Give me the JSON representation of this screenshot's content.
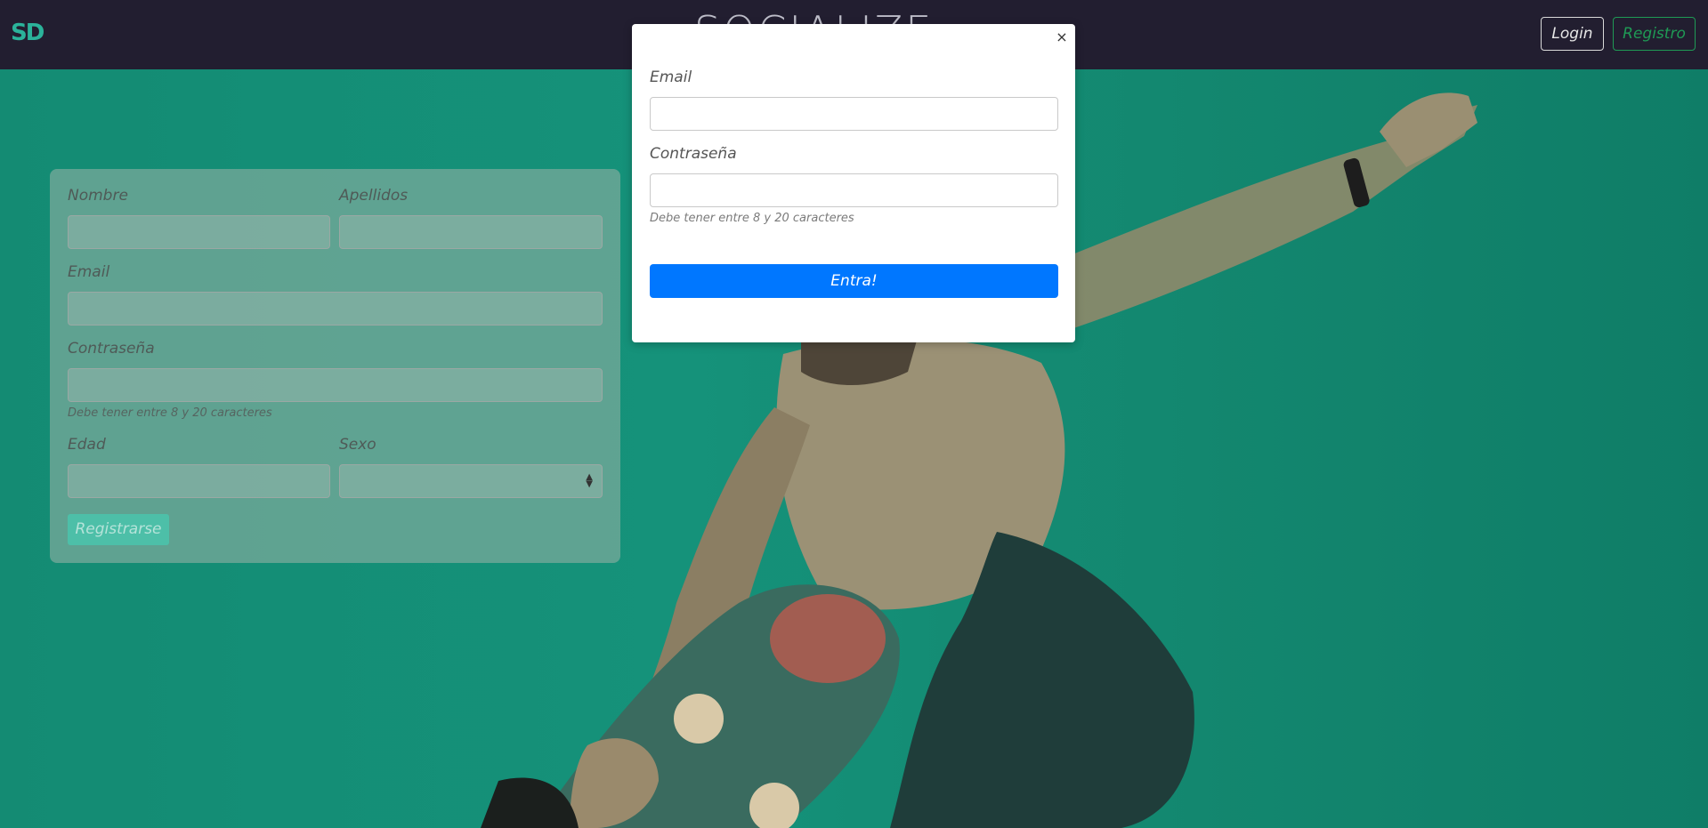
{
  "navbar": {
    "logo_text": "SD",
    "brand_title": "SOCIALIZE",
    "login_label": "Login",
    "register_label": "Registro"
  },
  "registration_form": {
    "first_name_label": "Nombre",
    "last_name_label": "Apellidos",
    "email_label": "Email",
    "password_label": "Contraseña",
    "password_help": "Debe tener entre 8 y 20 caracteres",
    "age_label": "Edad",
    "sex_label": "Sexo",
    "sex_selected": "",
    "submit_label": "Registrarse"
  },
  "login_modal": {
    "close_symbol": "×",
    "email_label": "Email",
    "email_value": "",
    "password_label": "Contraseña",
    "password_value": "",
    "password_help": "Debe tener entre 8 y 20 caracteres",
    "submit_label": "Entra!"
  },
  "colors": {
    "navbar_bg": "#221e30",
    "hero_teal": "#128a72",
    "primary_button": "#0077ff",
    "success_outline": "#1f9a55"
  }
}
